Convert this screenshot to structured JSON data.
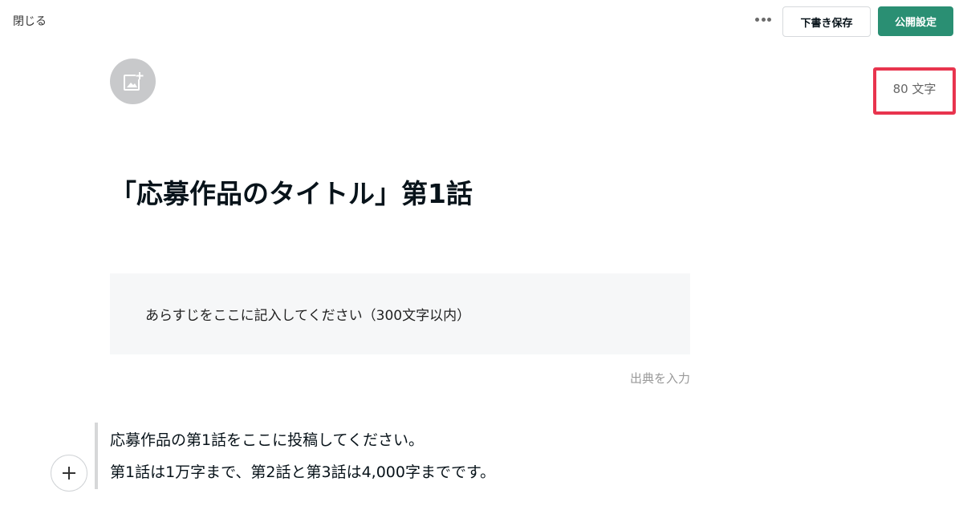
{
  "toolbar": {
    "close_label": "閉じる",
    "more_icon": "more-dots-icon",
    "draft_save_label": "下書き保存",
    "publish_settings_label": "公開設定"
  },
  "header": {
    "image_add_icon": "add-image-icon"
  },
  "stats": {
    "char_count": "80 文字",
    "highlight_color": "#e8344e"
  },
  "article": {
    "title": "「応募作品のタイトル」第1話",
    "synopsis_text": "あらすじをここに記入してください（300文字以内）",
    "source_placeholder": "出典を入力",
    "body_lines": [
      "応募作品の第1話をここに投稿してください。",
      "第1話は1万字まで、第2話と第3話は4,000字までです。"
    ],
    "add_block_icon": "plus-icon"
  },
  "colors": {
    "accent": "#2a8f73",
    "text": "#08131a",
    "synopsis_bg": "#f6f7f8"
  }
}
